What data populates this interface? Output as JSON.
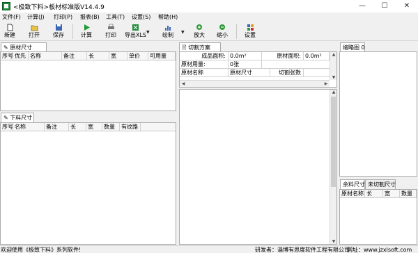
{
  "window": {
    "title": "<极致下料>板材标准版V14.4.9",
    "minimize": "—",
    "maximize": "☐",
    "close": "✕"
  },
  "menu": [
    "文件(F)",
    "计算(J)",
    "打印(P)",
    "报表(B)",
    "工具(T)",
    "设置(S)",
    "帮助(H)"
  ],
  "toolbar": {
    "new": "新建",
    "open": "打开",
    "save": "保存",
    "calc": "计算",
    "print": "打印",
    "export": "导出XLS",
    "draw": "绘制",
    "zoom_in": "放大",
    "zoom_out": "缩小",
    "settings": "设置"
  },
  "raw_panel": {
    "tab": "原材尺寸",
    "columns": [
      "序号",
      "优先",
      "名称",
      "备注",
      "长",
      "宽",
      "单价",
      "可用量"
    ]
  },
  "cut_panel": {
    "tab": "下料尺寸",
    "columns": [
      "序号",
      "名称",
      "备注",
      "长",
      "宽",
      "数量",
      "有纹路"
    ]
  },
  "plan_panel": {
    "tab": "切割方案",
    "rows": [
      [
        "成品面积:",
        "0.0m²",
        "原材面积:",
        "0.0m²"
      ],
      [
        "原材用量:",
        "0张",
        "",
        ""
      ],
      [
        "原材名称",
        "原材尺寸",
        "切割张数",
        ""
      ]
    ]
  },
  "thumb_panel": {
    "tab": "缩略图 0"
  },
  "remain_panel": {
    "tabs": [
      "余料尺寸",
      "未切割尺寸"
    ],
    "columns": [
      "原材名称",
      "长",
      "宽",
      "数量"
    ]
  },
  "status": {
    "welcome": "欢迎使用《极致下料》系列软件!",
    "developer": "研发者：淄博有思度软件工程有限公司",
    "website": "网址：www.jzxlsoft.com"
  },
  "colors": {
    "accent_green": "#1f8a3a",
    "zoom_green": "#2f9a3a",
    "tab_border": "#a9a9a9"
  }
}
